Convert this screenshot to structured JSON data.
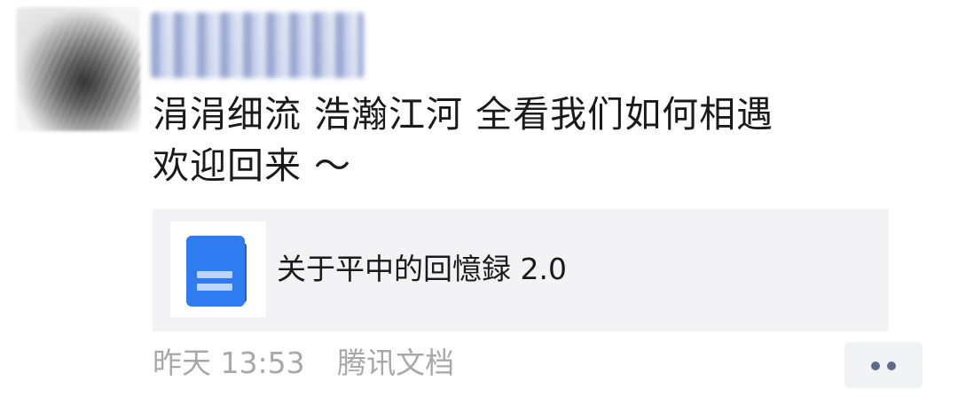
{
  "post": {
    "line1": "涓涓细流 浩瀚江河 全看我们如何相遇",
    "line2": "欢迎回来 ～"
  },
  "link_card": {
    "title": "关于平中的回憶録 2.0",
    "icon": "tencent-docs-document-icon"
  },
  "meta": {
    "time": "昨天 13:53",
    "source": "腾讯文档"
  },
  "more_button": {
    "icon": "more-dots-icon"
  },
  "colors": {
    "card_background": "#f3f3f5",
    "meta_text": "#a8a8a8",
    "doc_icon_blue": "#2f7bf0",
    "more_dots": "#5c6b8c"
  }
}
